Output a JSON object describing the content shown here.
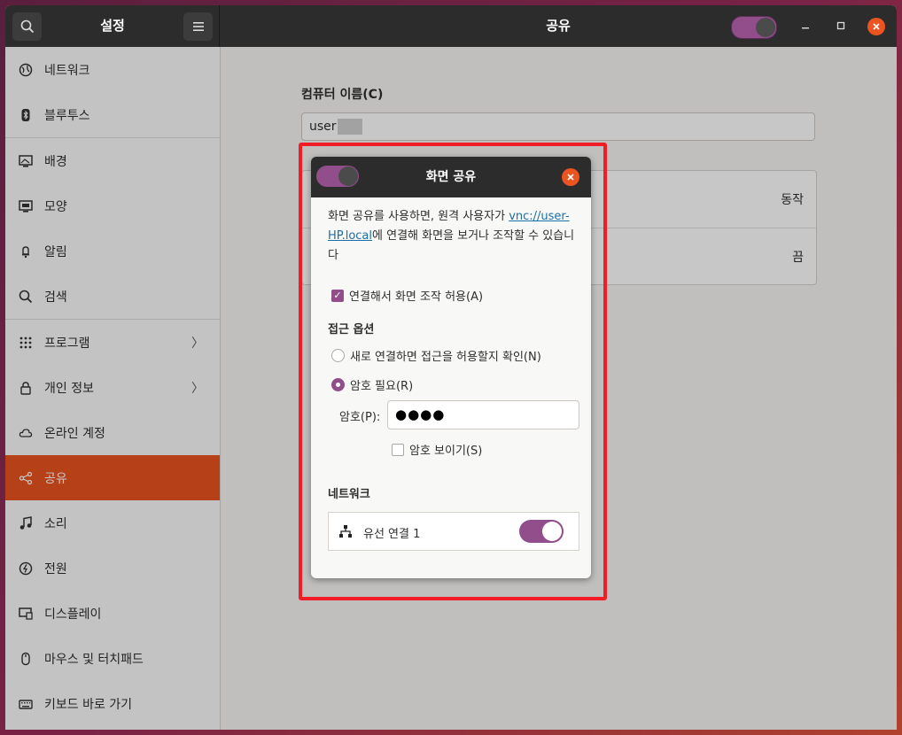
{
  "header": {
    "sidebar_title": "설정",
    "main_title": "공유",
    "search_icon": "search-icon",
    "menu_icon": "hamburger-icon",
    "sharing_toggle_on": true
  },
  "sidebar": {
    "items": [
      {
        "label": "네트워크",
        "icon": "network-icon"
      },
      {
        "label": "블루투스",
        "icon": "bluetooth-icon"
      },
      {
        "label": "배경",
        "icon": "background-icon"
      },
      {
        "label": "모양",
        "icon": "appearance-icon"
      },
      {
        "label": "알림",
        "icon": "bell-icon"
      },
      {
        "label": "검색",
        "icon": "search-icon"
      },
      {
        "label": "프로그램",
        "icon": "apps-grid-icon"
      },
      {
        "label": "개인 정보",
        "icon": "lock-icon"
      },
      {
        "label": "온라인 계정",
        "icon": "cloud-icon"
      },
      {
        "label": "공유",
        "icon": "share-icon"
      },
      {
        "label": "소리",
        "icon": "music-note-icon"
      },
      {
        "label": "전원",
        "icon": "power-icon"
      },
      {
        "label": "디스플레이",
        "icon": "display-icon"
      },
      {
        "label": "마우스 및 터치패드",
        "icon": "mouse-icon"
      },
      {
        "label": "키보드 바로 가기",
        "icon": "keyboard-icon"
      }
    ],
    "active_label": "공유"
  },
  "main": {
    "computer_name_label": "컴퓨터 이름(C)",
    "computer_name_value": "user",
    "rows": [
      {
        "value": "동작"
      },
      {
        "value": "끔"
      }
    ]
  },
  "dialog": {
    "title": "화면 공유",
    "desc_before": "화면 공유를 사용하면, 원격 사용자가 ",
    "desc_link": "vnc://user-HP.local",
    "desc_after": "에 연결해 화면을 보거나 조작할 수 있습니다",
    "allow_control_label": "연결해서 화면 조작 허용(A)",
    "allow_control_checked": true,
    "access_options_heading": "접근 옵션",
    "radio_confirm_label": "새로 연결하면 접근을 허용할지 확인(N)",
    "radio_password_label": "암호 필요(R)",
    "selected_option": "암호 필요(R)",
    "password_label": "암호(P):",
    "password_value": "●●●●",
    "show_password_label": "암호 보이기(S)",
    "show_password_checked": false,
    "network_heading": "네트워크",
    "network_item_label": "유선 연결 1",
    "network_item_enabled": true
  },
  "colors": {
    "accent": "#e95420",
    "toggle": "#924d8b",
    "highlight": "#f21c27"
  }
}
